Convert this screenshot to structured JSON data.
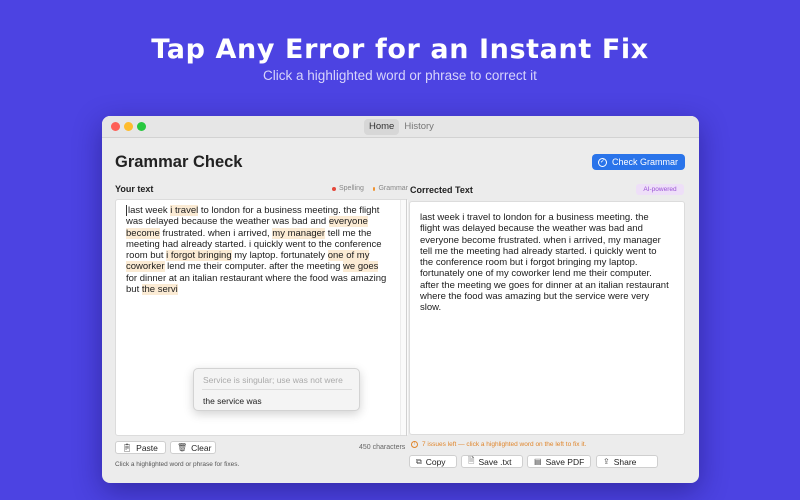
{
  "hero": {
    "title": "Tap Any Error for an Instant Fix",
    "subtitle": "Click a highlighted word or phrase to correct it"
  },
  "window": {
    "tabs": [
      {
        "label": "Home",
        "active": true
      },
      {
        "label": "History",
        "active": false
      }
    ]
  },
  "app": {
    "title": "Grammar Check",
    "check_button": "Check Grammar",
    "accent_color": "#2a74ea"
  },
  "input": {
    "label": "Your text",
    "legend": [
      {
        "label": "Spelling",
        "color": "#e5483b"
      },
      {
        "label": "Grammar",
        "color": "#f0922e"
      }
    ],
    "lines": [
      [
        {
          "t": "last week "
        },
        {
          "t": "i travel",
          "hl": true
        },
        {
          "t": " to london for a business meeting. the flight"
        }
      ],
      [
        {
          "t": "was delayed because the weather was bad and "
        },
        {
          "t": "everyone",
          "hl": true
        }
      ],
      [
        {
          "t": "become",
          "hl": true
        },
        {
          "t": " frustrated. when i arrived, "
        },
        {
          "t": "my manager",
          "hl": true
        },
        {
          "t": " tell me the"
        }
      ],
      [
        {
          "t": "meeting had already started. i quickly went to the conference"
        }
      ],
      [
        {
          "t": "room but "
        },
        {
          "t": "i forgot bringing",
          "hl": true
        },
        {
          "t": " my laptop. fortunately "
        },
        {
          "t": "one of my",
          "hl": true
        }
      ],
      [
        {
          "t": "coworker",
          "hl": true
        },
        {
          "t": " lend me their computer. after the meeting "
        },
        {
          "t": "we goes",
          "hl": true
        }
      ],
      [
        {
          "t": "for dinner at an italian restaurant where the food was amazing"
        }
      ],
      [
        {
          "t": "but "
        },
        {
          "t": "the servi",
          "hl": true
        }
      ]
    ],
    "char_count": "450 characters",
    "paste_label": "Paste",
    "clear_label": "Clear",
    "hint": "Click a highlighted word or phrase for fixes."
  },
  "popup": {
    "hint": "Service is singular; use was not were",
    "suggestion": "the service was"
  },
  "output": {
    "label": "Corrected Text",
    "badge": "AI-powered",
    "lines": [
      "last week i travel to london for a business meeting. the",
      "flight was delayed because the weather was bad and",
      "everyone become frustrated. when i arrived, my manager",
      "tell me the meeting had already started. i quickly went to",
      "the conference room but i forgot bringing my laptop.",
      "fortunately one of my coworker lend me their computer.",
      "after the meeting we goes for dinner at an italian restaurant",
      "where the food was amazing but the service were very",
      "slow."
    ],
    "issues": "7 issues left — click a highlighted word on the left to fix it.",
    "buttons": [
      {
        "label": "Copy",
        "icon": "copy-icon"
      },
      {
        "label": "Save .txt",
        "icon": "document-icon"
      },
      {
        "label": "Save PDF",
        "icon": "pdf-icon"
      },
      {
        "label": "Share",
        "icon": "share-icon"
      }
    ]
  }
}
